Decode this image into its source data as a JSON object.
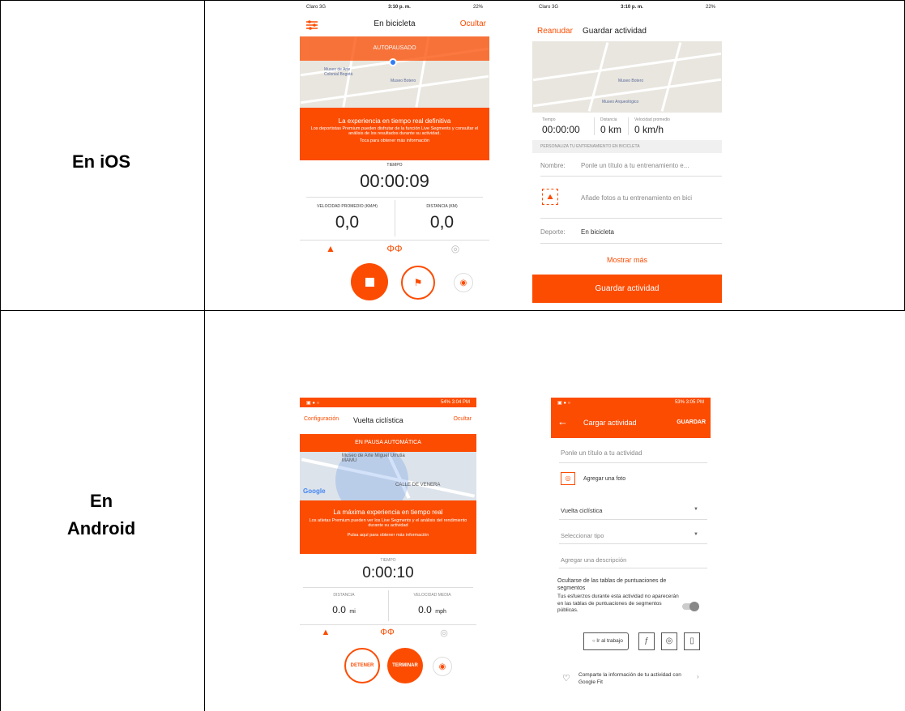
{
  "table": {
    "ios_label": "En iOS",
    "android_label_line1": "En",
    "android_label_line2": "Android"
  },
  "ios_record": {
    "status_carrier": "Claro 3G",
    "status_time": "3:10 p. m.",
    "status_battery": "22%",
    "settings_icon": "sliders-icon",
    "title": "En bicicleta",
    "hide": "Ocultar",
    "autopause": "AUTOPAUSADO",
    "map_label_1": "Museo de Arte Colonial Bogotá",
    "map_label_2": "Museo Botero",
    "promo_title": "La experiencia en tiempo real definitiva",
    "promo_body": "Los deportistas Premium pueden disfrutar de la función Live Segments y consultar el análisis de los resultados durante su actividad.",
    "promo_cta": "Toca para obtener más información",
    "time_label": "TIEMPO",
    "time_value": "00:00:09",
    "speed_label": "VELOCIDAD PROMEDIO (KM/H)",
    "speed_value": "0,0",
    "distance_label": "DISTANCIA (KM)",
    "distance_value": "0,0"
  },
  "ios_save": {
    "status_carrier": "Claro 3G",
    "status_time": "3:10 p. m.",
    "status_battery": "22%",
    "resume": "Reanudar",
    "title": "Guardar actividad",
    "map_label": "Museo Botero",
    "map_label_2": "Museo Arqueológico",
    "stat_time_label": "Tiempo",
    "stat_time_value": "00:00:00",
    "stat_distance_label": "Distancia",
    "stat_distance_value": "0 km",
    "stat_speed_label": "Velocidad promedio",
    "stat_speed_value": "0 km/h",
    "section_header": "PERSONALIZA TU ENTRENAMIENTO EN BICICLETA",
    "name_label": "Nombre:",
    "name_placeholder": "Ponle un título a tu entrenamiento e...",
    "photo_text": "Añade fotos a tu entrenamiento en bici",
    "sport_label": "Deporte:",
    "sport_value": "En bicicleta",
    "show_more": "Mostrar más",
    "save_button": "Guardar actividad"
  },
  "android_record": {
    "status_right": "54% 3:04 PM",
    "config": "Configuración",
    "title": "Vuelta ciclística",
    "hide": "Ocultar",
    "autopause": "EN PAUSA AUTOMÁTICA",
    "map_label_1": "Museo de Arte Miguel Urrutia MAMU",
    "map_label_2": "CALLE DE VENERA",
    "google": "Google",
    "promo_title": "La máxima experiencia en tiempo real",
    "promo_body": "Los atletas Premium pueden ver los Live Segments y el análisis del rendimiento durante su actividad",
    "promo_cta": "Pulsa aquí para obtener más información",
    "time_label": "TIEMPO",
    "time_value": "0:00:10",
    "distance_label": "DISTANCIA",
    "distance_value": "0.0",
    "distance_unit": "mi",
    "speed_label": "VELOCIDAD MEDIA",
    "speed_value": "0.0",
    "speed_unit": "mph",
    "stop_button": "DETENER",
    "finish_button": "TERMINAR"
  },
  "android_save": {
    "status_right": "53% 3:05 PM",
    "title": "Cargar actividad",
    "save": "GUARDAR",
    "title_placeholder": "Ponle un título a tu actividad",
    "add_photo": "Agregar una foto",
    "activity_type": "Vuelta ciclística",
    "select_type": "Seleccionar tipo",
    "description_placeholder": "Agregar una descripción",
    "hide_leaderboards_title": "Ocultarse de las tablas de puntuaciones de segmentos",
    "hide_leaderboards_body": "Tus esfuerzos durante esta actividad no aparecerán en las tablas de puntuaciones de segmentos públicas.",
    "commute_tag": "Ir al trabajo",
    "google_fit": "Comparte la información de tu actividad con Google Fit"
  },
  "colors": {
    "accent": "#fc4c02"
  }
}
